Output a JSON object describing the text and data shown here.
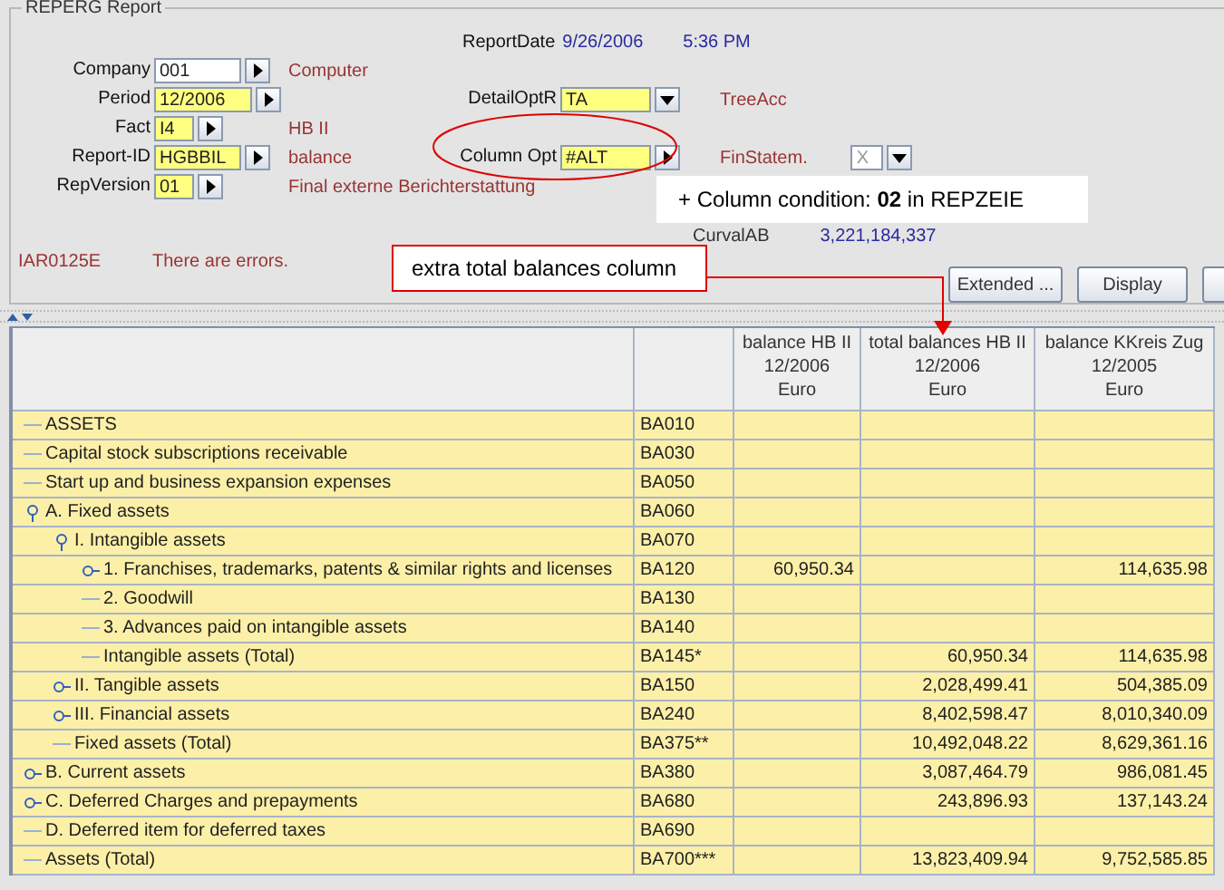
{
  "panel": {
    "title": "REPERG Report",
    "report_date": {
      "label": "ReportDate",
      "date": "9/26/2006",
      "time": "5:36 PM"
    },
    "fields": [
      {
        "label": "Company",
        "value": "001",
        "highlighted": false,
        "description": "Computer"
      },
      {
        "label": "Period",
        "value": "12/2006",
        "highlighted": true
      },
      {
        "label": "Fact",
        "value": "I4",
        "highlighted": true,
        "description": "HB II"
      },
      {
        "label": "Report-ID",
        "value": "HGBBIL",
        "highlighted": true,
        "description": "balance"
      },
      {
        "label": "RepVersion",
        "value": "01",
        "highlighted": true,
        "description": "Final externe Berichterstattung"
      }
    ],
    "right_fields": [
      {
        "label": "DetailOptR",
        "value": "TA",
        "kind": "dropdown",
        "description": "TreeAcc"
      },
      {
        "label": "Column Opt",
        "value": "#ALT",
        "kind": "arrow",
        "description": "FinStatem.",
        "option": "X"
      }
    ],
    "curval": {
      "label": "CurvalAB",
      "value": "3,221,184,337"
    },
    "message": {
      "code": "IAR0125E",
      "text": "There are errors."
    },
    "buttons": [
      "Extended ...",
      "Display"
    ]
  },
  "annotations": {
    "column_condition": "+ Column condition: **02** in REPZEIE",
    "extra_column": "extra total balances column"
  },
  "table": {
    "columns": [
      {
        "lines": [
          "balance HB II",
          "12/2006",
          "Euro"
        ]
      },
      {
        "lines": [
          "total balances HB II",
          "12/2006",
          "Euro"
        ]
      },
      {
        "lines": [
          "balance KKreis Zug",
          "12/2005",
          "Euro"
        ]
      }
    ],
    "rows": [
      {
        "label": "ASSETS",
        "code": "BA010",
        "kind": "leaf"
      },
      {
        "label": "Capital stock subscriptions receivable",
        "code": "BA030",
        "kind": "leaf"
      },
      {
        "label": "Start up and business expansion expenses",
        "code": "BA050",
        "kind": "leaf"
      },
      {
        "label": "A. Fixed assets",
        "code": "BA060",
        "kind": "group",
        "expanded": true,
        "children": [
          {
            "label": "I. Intangible assets",
            "code": "BA070",
            "kind": "group",
            "expanded": true,
            "children": [
              {
                "label": "1. Franchises, trademarks, patents & similar rights and licenses",
                "code": "BA120",
                "kind": "group",
                "expanded": false,
                "col_1": "60,950.34",
                "col_3": "114,635.98"
              },
              {
                "label": "2. Goodwill",
                "code": "BA130",
                "kind": "leaf"
              },
              {
                "label": "3. Advances paid on intangible assets",
                "code": "BA140",
                "kind": "leaf"
              },
              {
                "label": "Intangible assets (Total)",
                "code": "BA145*",
                "kind": "leaf",
                "col_2": "60,950.34",
                "col_3": "114,635.98"
              }
            ]
          },
          {
            "label": "II. Tangible assets",
            "code": "BA150",
            "kind": "group",
            "expanded": false,
            "col_2": "2,028,499.41",
            "col_3": "504,385.09"
          },
          {
            "label": "III. Financial assets",
            "code": "BA240",
            "kind": "group",
            "expanded": false,
            "col_2": "8,402,598.47",
            "col_3": "8,010,340.09"
          },
          {
            "label": "Fixed assets (Total)",
            "code": "BA375**",
            "kind": "leaf",
            "col_2": "10,492,048.22",
            "col_3": "8,629,361.16"
          }
        ]
      },
      {
        "label": "B. Current assets",
        "code": "BA380",
        "kind": "group",
        "expanded": false,
        "col_2": "3,087,464.79",
        "col_3": "986,081.45"
      },
      {
        "label": "C. Deferred Charges and prepayments",
        "code": "BA680",
        "kind": "group",
        "expanded": false,
        "col_2": "243,896.93",
        "col_3": "137,143.24"
      },
      {
        "label": "D. Deferred item for deferred taxes",
        "code": "BA690",
        "kind": "leaf"
      },
      {
        "label": "Assets (Total)",
        "code": "BA700***",
        "kind": "leaf",
        "col_2": "13,823,409.94",
        "col_3": "9,752,585.85"
      }
    ]
  }
}
